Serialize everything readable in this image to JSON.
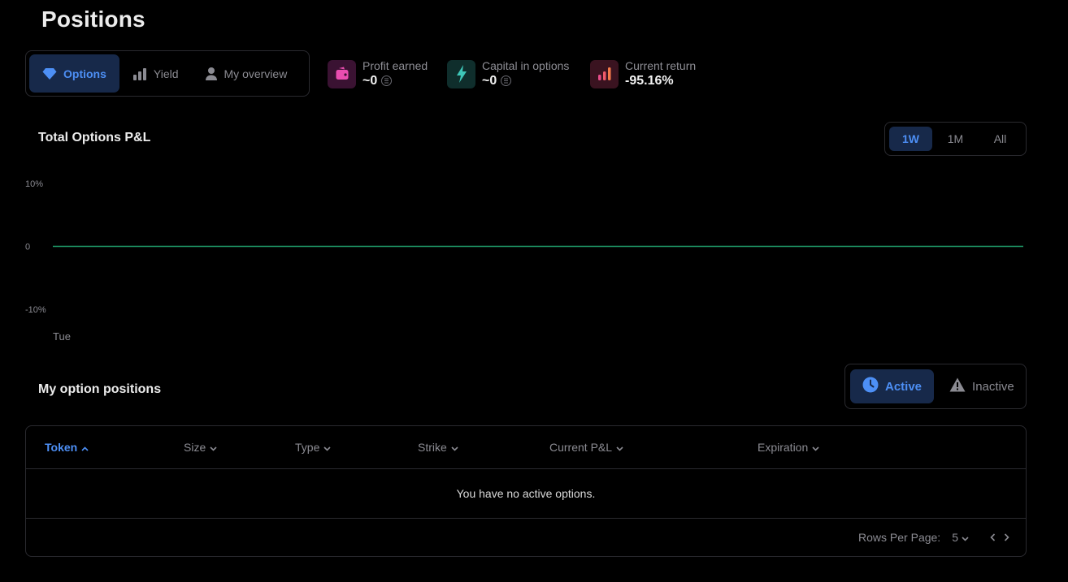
{
  "page": {
    "title": "Positions"
  },
  "main_tabs": [
    {
      "label": "Options",
      "icon": "diamond-icon",
      "active": true
    },
    {
      "label": "Yield",
      "icon": "bar-chart-icon",
      "active": false
    },
    {
      "label": "My overview",
      "icon": "user-icon",
      "active": false
    }
  ],
  "stats": {
    "profit": {
      "label": "Profit earned",
      "value": "~0",
      "icon": "wallet-icon",
      "color": "#e94db0"
    },
    "capital": {
      "label": "Capital in options",
      "value": "~0",
      "icon": "lightning-icon",
      "color": "#3ec6b8"
    },
    "return": {
      "label": "Current return",
      "value": "-95.16%",
      "icon": "bars-up-icon",
      "color": "#f05a6a"
    }
  },
  "pnl": {
    "title": "Total Options P&L",
    "ranges": [
      {
        "label": "1W",
        "active": true
      },
      {
        "label": "1M",
        "active": false
      },
      {
        "label": "All",
        "active": false
      }
    ]
  },
  "chart_data": {
    "type": "line",
    "title": "Total Options P&L",
    "x": [
      "Tue"
    ],
    "series": [
      {
        "values": [
          0,
          0
        ]
      }
    ],
    "y_ticks": [
      "10%",
      "0",
      "-10%"
    ],
    "ylim": [
      -10,
      10
    ],
    "line_color": "#1f9d6b",
    "grid": false
  },
  "positions": {
    "title": "My option positions",
    "status_tabs": [
      {
        "label": "Active",
        "icon": "clock-icon",
        "active": true
      },
      {
        "label": "Inactive",
        "icon": "warning-icon",
        "active": false
      }
    ],
    "columns": [
      {
        "label": "Token",
        "sort": "asc",
        "active": true
      },
      {
        "label": "Size",
        "sort": "desc",
        "active": false
      },
      {
        "label": "Type",
        "sort": "desc",
        "active": false
      },
      {
        "label": "Strike",
        "sort": "desc",
        "active": false
      },
      {
        "label": "Current P&L",
        "sort": "desc",
        "active": false
      },
      {
        "label": "Expiration",
        "sort": "desc",
        "active": false
      }
    ],
    "empty_message": "You have no active options.",
    "pagination": {
      "rows_label": "Rows Per Page:",
      "rows_value": "5"
    }
  },
  "colors": {
    "accent": "#4d8ff5",
    "accent_bg": "#17294a",
    "border": "#2a2a2f"
  }
}
